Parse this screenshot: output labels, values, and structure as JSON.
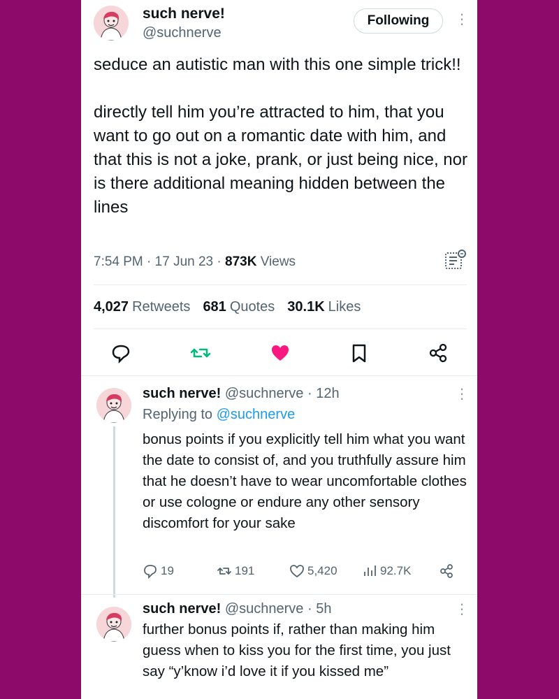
{
  "tweet": {
    "display_name": "such nerve!",
    "handle": "@suchnerve",
    "follow_label": "Following",
    "text": "seduce an autistic man with this one simple trick!!\n\ndirectly tell him you’re attracted to him, that you want to go out on a romantic date with him, and that this is not a joke, prank, or just being nice, nor is there additional meaning hidden between the lines",
    "time": "7:54 PM",
    "date": "17 Jun 23",
    "views_count": "873K",
    "views_label": "Views",
    "retweets_count": "4,027",
    "retweets_label": "Retweets",
    "quotes_count": "681",
    "quotes_label": "Quotes",
    "likes_count": "30.1K",
    "likes_label": "Likes",
    "liked": true,
    "like_color": "#f91880",
    "retweet_color": "#00ba7c"
  },
  "replies": [
    {
      "display_name": "such nerve!",
      "handle": "@suchnerve",
      "age": "12h",
      "replying_prefix": "Replying to",
      "replying_to": "@suchnerve",
      "text": "bonus points if you explicitly tell him what you want the date to consist of, and you truthfully assure him that he doesn’t have to wear uncomfortable clothes or use cologne or endure any other sensory discomfort for your sake",
      "replies_count": "19",
      "retweets_count": "191",
      "likes_count": "5,420",
      "views_count": "92.7K"
    },
    {
      "display_name": "such nerve!",
      "handle": "@suchnerve",
      "age": "5h",
      "text": "further bonus points if, rather than making him guess when to kiss you for the first time, you just say “y’know i’d love it if you kissed me”"
    }
  ],
  "colors": {
    "background": "#8d0a6b",
    "card": "#ffffff",
    "link": "#1d9bf0",
    "muted": "#536471"
  },
  "icons": [
    "dots-icon",
    "analytics-icon",
    "reply-icon",
    "retweet-icon",
    "heart-icon",
    "bookmark-icon",
    "share-icon",
    "views-icon"
  ]
}
